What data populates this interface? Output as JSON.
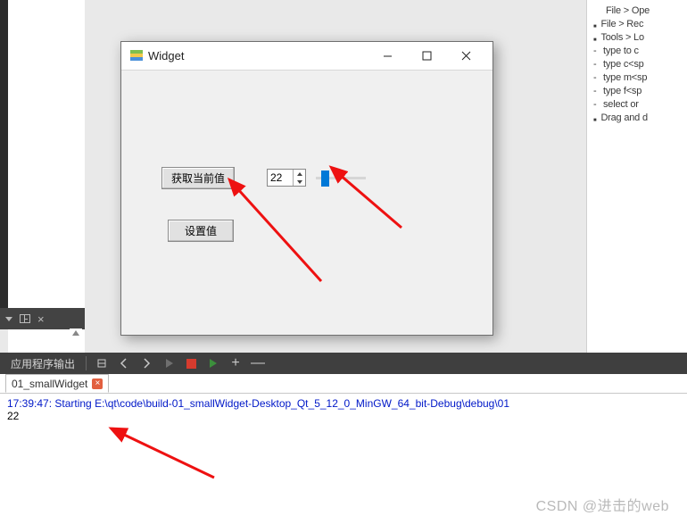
{
  "hint": {
    "l0": "File > Ope",
    "l1": "File > Rec",
    "l2": "Tools > Lo",
    "l3": "type to c",
    "l4": "type c<sp",
    "l5": "type m<sp",
    "l6": "type f<sp",
    "l7": "select or",
    "l8": "Drag and d"
  },
  "window": {
    "title": "Widget",
    "btn_get": "获取当前值",
    "btn_set": "设置值",
    "spin_value": "22"
  },
  "output": {
    "title": "应用程序输出",
    "tab": "01_smallWidget",
    "line1": "17:39:47: Starting E:\\qt\\code\\build-01_smallWidget-Desktop_Qt_5_12_0_MinGW_64_bit-Debug\\debug\\01",
    "line2": "22"
  },
  "watermark": "CSDN @进击的web"
}
